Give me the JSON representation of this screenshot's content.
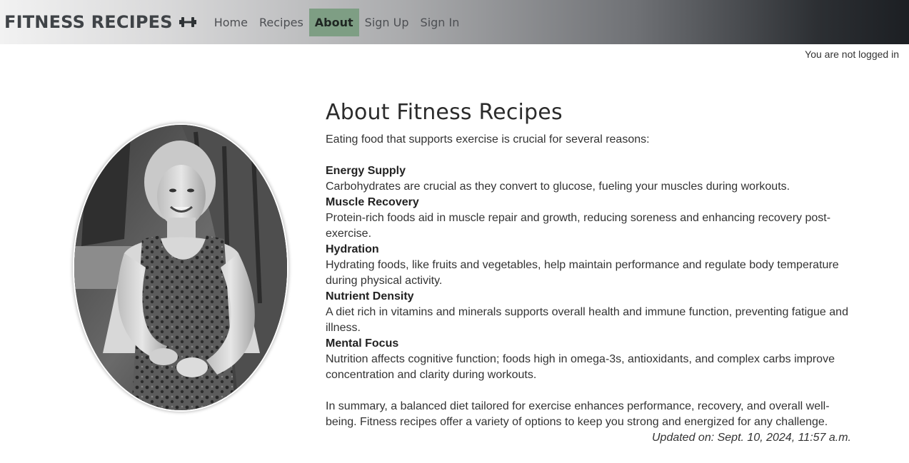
{
  "navbar": {
    "brand": "FITNESS RECIPES",
    "brand_icon": "dumbbell-icon",
    "links": [
      {
        "label": "Home",
        "active": false
      },
      {
        "label": "Recipes",
        "active": false
      },
      {
        "label": "About",
        "active": true
      },
      {
        "label": "Sign Up",
        "active": false
      },
      {
        "label": "Sign In",
        "active": false
      }
    ],
    "active_color": "#7e9e84"
  },
  "status": {
    "login_text": "You are not logged in"
  },
  "about": {
    "title": "About Fitness Recipes",
    "intro": "Eating food that supports exercise is crucial for several reasons:",
    "sections": [
      {
        "title": "Energy Supply",
        "body": "Carbohydrates are crucial as they convert to glucose, fueling your muscles during workouts."
      },
      {
        "title": "Muscle Recovery",
        "body": "Protein-rich foods aid in muscle repair and growth, reducing soreness and enhancing recovery post-exercise."
      },
      {
        "title": "Hydration",
        "body": "Hydrating foods, like fruits and vegetables, help maintain performance and regulate body temperature during physical activity."
      },
      {
        "title": "Nutrient Density",
        "body": "A diet rich in vitamins and minerals supports overall health and immune function, preventing fatigue and illness."
      },
      {
        "title": "Mental Focus",
        "body": "Nutrition affects cognitive function; foods high in omega-3s, antioxidants, and complex carbs improve concentration and clarity during workouts."
      }
    ],
    "summary": "In summary, a balanced diet tailored for exercise enhances performance, recovery, and overall well-being. Fitness recipes offer a variety of options to keep you strong and energized for any challenge.",
    "updated": "Updated on: Sept. 10, 2024, 11:57 a.m."
  }
}
